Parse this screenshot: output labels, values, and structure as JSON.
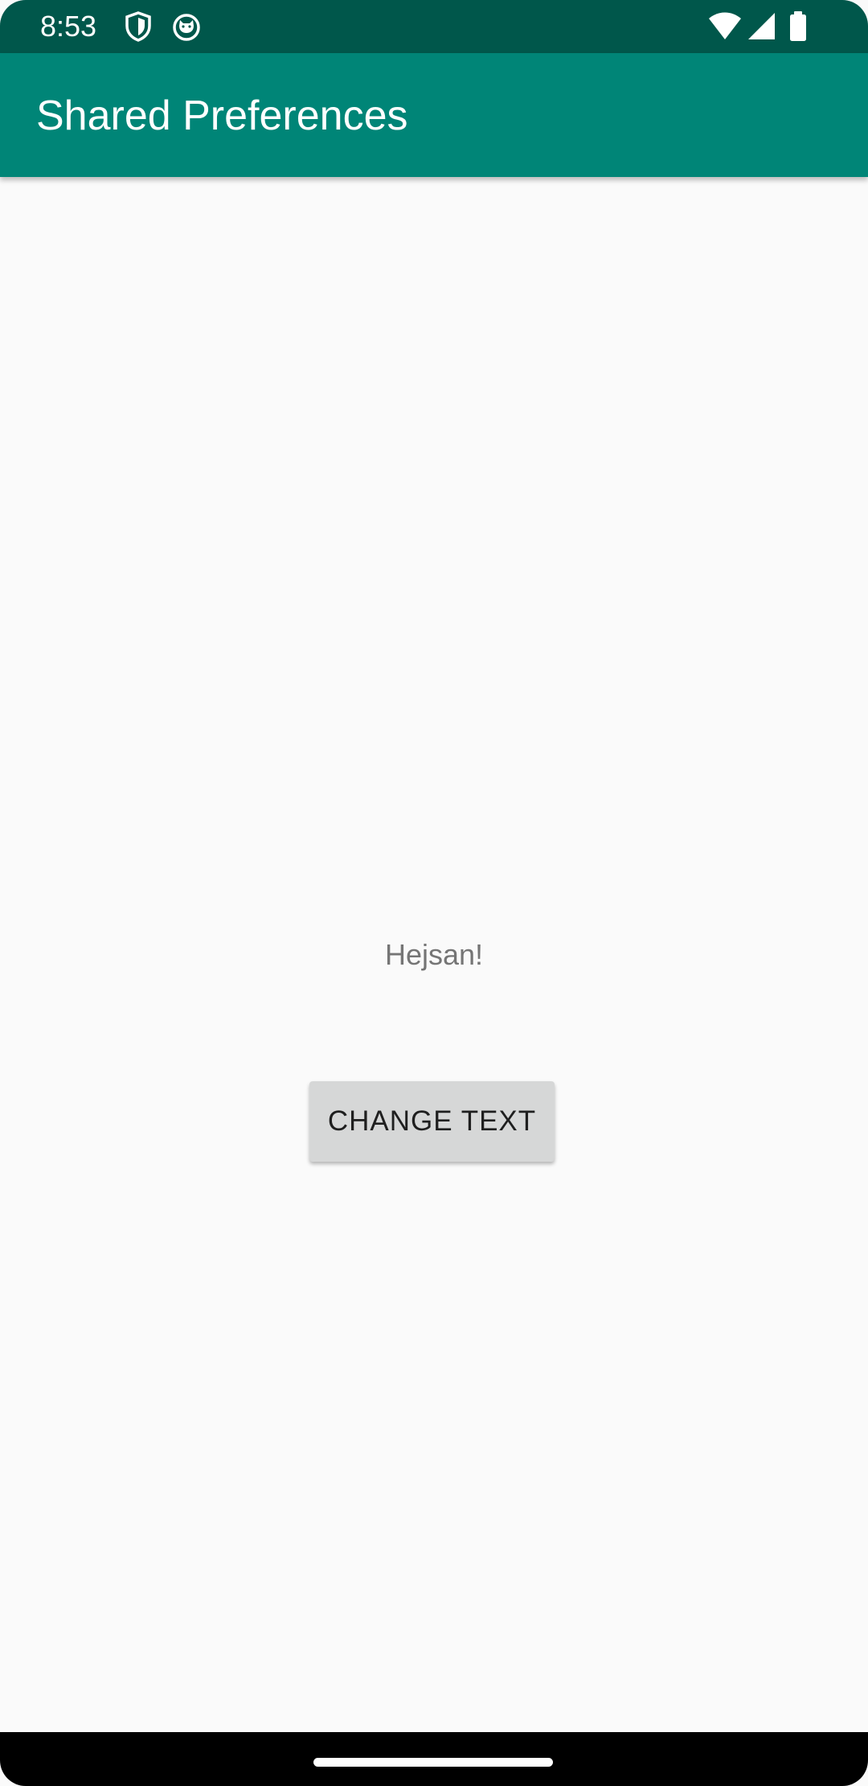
{
  "status_bar": {
    "time": "8:53",
    "icons": [
      "shield-icon",
      "cat-face-icon",
      "wifi-icon",
      "signal-icon",
      "battery-icon"
    ]
  },
  "app_bar": {
    "title": "Shared Preferences",
    "color": "#008577"
  },
  "main": {
    "message": "Hejsan!",
    "button_label": "CHANGE TEXT"
  },
  "colors": {
    "status_bar": "#00574b",
    "background": "#fafafa",
    "button": "#d6d7d7"
  }
}
